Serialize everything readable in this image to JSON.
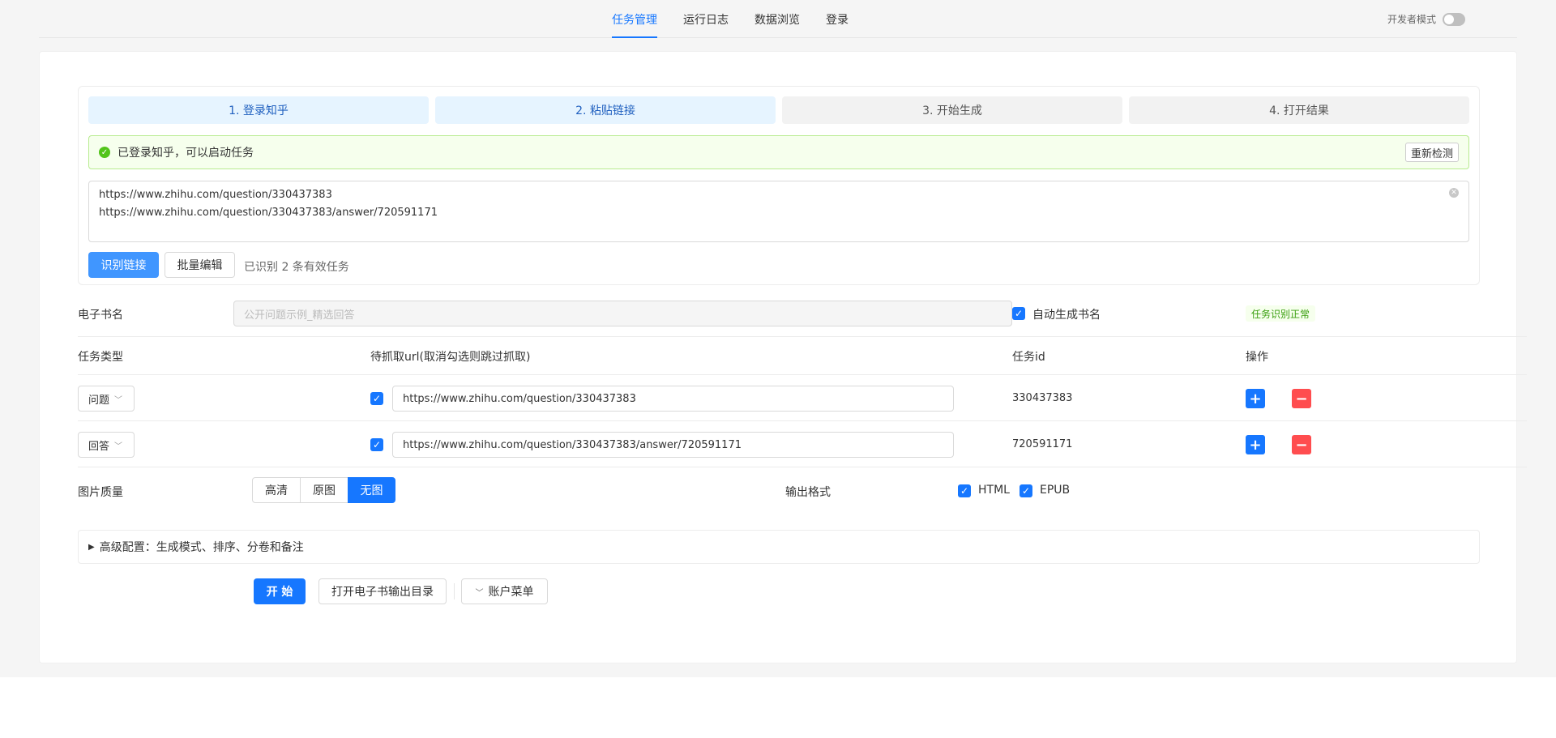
{
  "nav": {
    "tabs": [
      {
        "label": "任务管理",
        "active": true
      },
      {
        "label": "运行日志",
        "active": false
      },
      {
        "label": "数据浏览",
        "active": false
      },
      {
        "label": "登录",
        "active": false
      }
    ],
    "dev_mode_label": "开发者模式",
    "dev_mode_on": false
  },
  "steps": [
    {
      "label": "1. 登录知乎",
      "state": "done"
    },
    {
      "label": "2. 粘贴链接",
      "state": "done"
    },
    {
      "label": "3. 开始生成",
      "state": "todo"
    },
    {
      "label": "4. 打开结果",
      "state": "todo"
    }
  ],
  "alert": {
    "text": "已登录知乎，可以启动任务",
    "recheck_label": "重新检测"
  },
  "url_box": {
    "lines": [
      "https://www.zhihu.com/question/330437383",
      "https://www.zhihu.com/question/330437383/answer/720591171"
    ]
  },
  "actions": {
    "recognize_label": "识别链接",
    "batch_edit_label": "批量编辑",
    "status": "已识别 2 条有效任务"
  },
  "ebook": {
    "label": "电子书名",
    "placeholder": "公开问题示例_精选回答",
    "auto_name_label": "自动生成书名",
    "auto_name_checked": true,
    "status_tag": "任务识别正常"
  },
  "table": {
    "headers": {
      "type": "任务类型",
      "url": "待抓取url(取消勾选则跳过抓取)",
      "id": "任务id",
      "ops": "操作"
    },
    "rows": [
      {
        "type": "问题",
        "checked": true,
        "url": "https://www.zhihu.com/question/330437383",
        "id": "330437383"
      },
      {
        "type": "回答",
        "checked": true,
        "url": "https://www.zhihu.com/question/330437383/answer/720591171",
        "id": "720591171"
      }
    ]
  },
  "quality": {
    "label": "图片质量",
    "options": [
      "高清",
      "原图",
      "无图"
    ],
    "selected": "无图"
  },
  "output": {
    "label": "输出格式",
    "html_label": "HTML",
    "html_checked": true,
    "epub_label": "EPUB",
    "epub_checked": true
  },
  "advanced": {
    "label": "高级配置：生成模式、排序、分卷和备注"
  },
  "footer": {
    "start_label": "开 始",
    "open_dir_label": "打开电子书输出目录",
    "account_menu_label": "账户菜单"
  },
  "colors": {
    "primary": "#1677ff",
    "danger": "#ff4d4f",
    "success": "#52c41a"
  }
}
